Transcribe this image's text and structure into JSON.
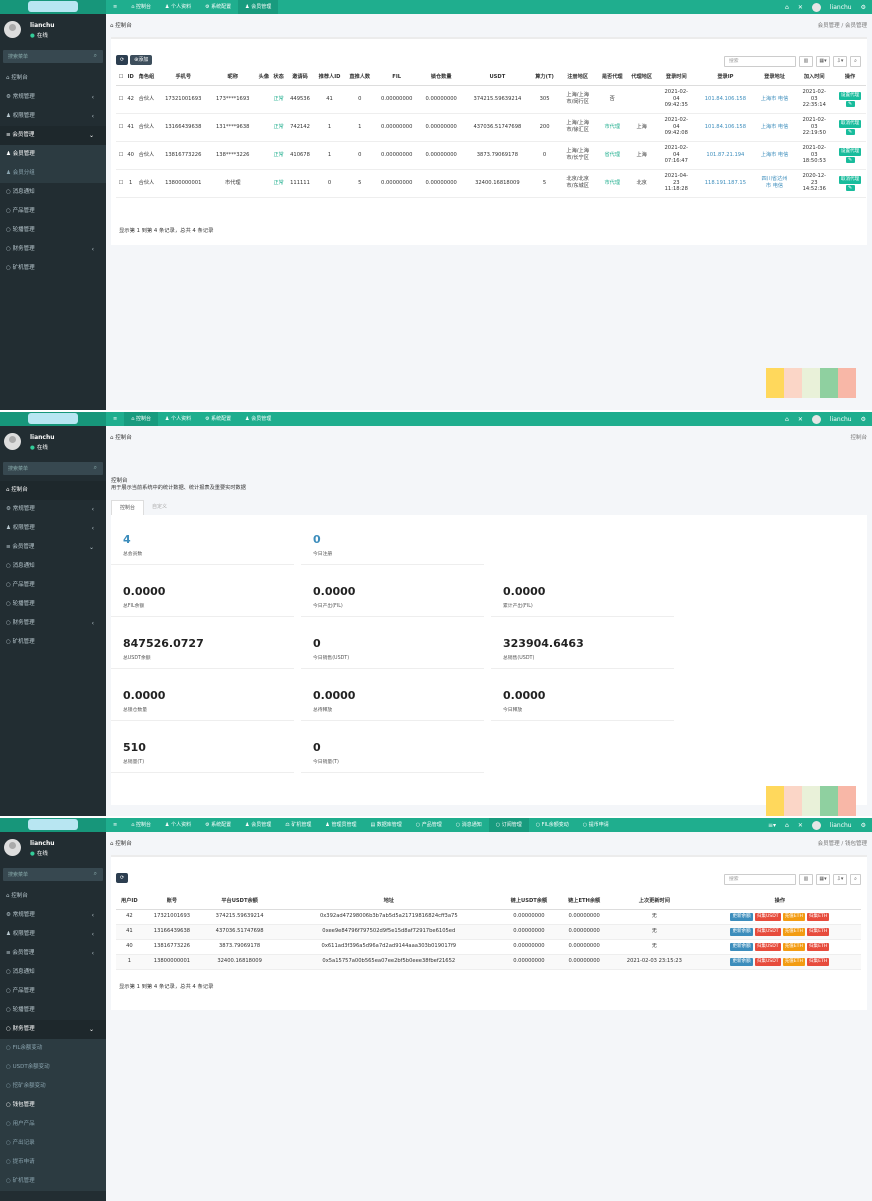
{
  "topnav": {
    "toggle": "≡",
    "dashboard": "控制台",
    "profile": "个人资料",
    "system": "系统配置",
    "member": "会员管理",
    "miner": "矿机管理",
    "admin": "管理员管理",
    "data": "数据库管理",
    "product": "产品管理",
    "notice": "消息通知",
    "subscribe": "订阅管理",
    "fil": "FIL余额变动",
    "withdraw": "提币申请"
  },
  "user": {
    "name": "lianchu",
    "status": "在线"
  },
  "search_placeholder": "搜索菜单",
  "menu": {
    "console": "控制台",
    "general": "常规管理",
    "auth": "权限管理",
    "member": "会员管理",
    "member_mgmt": "会员管理",
    "member_group": "会员分组",
    "notice": "消息通知",
    "product": "产品管理",
    "subscribe": "轮播管理",
    "finance": "财务管理",
    "miner": "矿机管理",
    "fil_change": "FIL余额变动",
    "usdt_change": "USDT余额变动",
    "dig_change": "挖矿余额变动",
    "withdraw_mgmt": "钱包管理",
    "user_products": "用户产品",
    "output": "产出记录",
    "withdraw_apply": "提币申请"
  },
  "p1": {
    "crumb": "控制台",
    "breadcrumb": "会员管理 / 会员管理",
    "add": "添加",
    "search": "搜索",
    "headers": [
      "ID",
      "角色组",
      "手机号",
      "昵称",
      "头像",
      "状态",
      "邀请码",
      "推荐人ID",
      "直推人数",
      "FIL",
      "锁仓数量",
      "USDT",
      "算力(T)",
      "注册地区",
      "是否代理",
      "代理地区",
      "登录时间",
      "登录IP",
      "登录地址",
      "加入时间",
      "操作"
    ],
    "rows": [
      {
        "id": "42",
        "role": "合伙人",
        "phone": "17321001693",
        "nick": "173****1693",
        "status": "正常",
        "code": "449536",
        "ref": "41",
        "direct": "0",
        "fil": "0.00000000",
        "lock": "0.00000000",
        "usdt": "374215.59639214",
        "power": "305",
        "region": "上海/上海市/闵行区",
        "agent": "否",
        "agent_region": "",
        "login_time": "2021-02-04 09:42:35",
        "ip": "101.84.106.158",
        "addr": "上海市 电信",
        "join": "2021-02-03 22:35:14",
        "op": "设置代理"
      },
      {
        "id": "41",
        "role": "合伙人",
        "phone": "13166439638",
        "nick": "131****9638",
        "status": "正常",
        "code": "742142",
        "ref": "1",
        "direct": "1",
        "fil": "0.00000000",
        "lock": "0.00000000",
        "usdt": "437036.51747698",
        "power": "200",
        "region": "上海/上海市/徐汇区",
        "agent": "市代理",
        "agent_region": "上海",
        "login_time": "2021-02-04 09:42:08",
        "ip": "101.84.106.158",
        "addr": "上海市 电信",
        "join": "2021-02-03 22:19:50",
        "op": "取消代理"
      },
      {
        "id": "40",
        "role": "合伙人",
        "phone": "13816773226",
        "nick": "138****3226",
        "status": "正常",
        "code": "410678",
        "ref": "1",
        "direct": "0",
        "fil": "0.00000000",
        "lock": "0.00000000",
        "usdt": "3873.79069178",
        "power": "0",
        "region": "上海/上海市/长宁区",
        "agent": "省代理",
        "agent_region": "上海",
        "login_time": "2021-02-04 07:16:47",
        "ip": "101.87.21.194",
        "addr": "上海市 电信",
        "join": "2021-02-03 18:50:53",
        "op": "设置代理"
      },
      {
        "id": "1",
        "role": "合伙人",
        "phone": "13800000001",
        "nick": "市代理",
        "status": "正常",
        "code": "111111",
        "ref": "0",
        "direct": "5",
        "fil": "0.00000000",
        "lock": "0.00000000",
        "usdt": "32400.16818009",
        "power": "5",
        "region": "北京/北京市/东城区",
        "agent": "市代理",
        "agent_region": "北京",
        "login_time": "2021-04-23 11:18:28",
        "ip": "118.191.187.15",
        "addr": "四川省达州市 电信",
        "join": "2020-12-23 14:52:36",
        "op": "取消代理"
      }
    ],
    "footer": "显示第 1 到第 4 条记录，总共 4 条记录"
  },
  "p2": {
    "crumb": "控制台",
    "right": "控制台",
    "title": "控制台",
    "subtitle": "用于展示当前系统中的统计数据、统计报表及重要实时数据",
    "tab1": "控制台",
    "tab2": "自定义",
    "stats": [
      {
        "v": "4",
        "l": "总会员数"
      },
      {
        "v": "0",
        "l": "今日注册"
      },
      {
        "v": "0.0000",
        "l": "总FIL余额"
      },
      {
        "v": "0.0000",
        "l": "今日产出(FIL)"
      },
      {
        "v": "0.0000",
        "l": "累计产出(FIL)"
      },
      {
        "v": "847526.0727",
        "l": "总USDT余额"
      },
      {
        "v": "0",
        "l": "今日销售(USDT)"
      },
      {
        "v": "323904.6463",
        "l": "总销售(USDT)"
      },
      {
        "v": "0.0000",
        "l": "总锁仓数量"
      },
      {
        "v": "0.0000",
        "l": "总待释放"
      },
      {
        "v": "0.0000",
        "l": "今日释放"
      },
      {
        "v": "510",
        "l": "总销量(T)"
      },
      {
        "v": "0",
        "l": "今日销量(T)"
      }
    ]
  },
  "p3": {
    "crumb": "控制台",
    "breadcrumb": "会员管理 / 钱包管理",
    "search": "搜索",
    "headers": [
      "用户ID",
      "账号",
      "平台USDT余额",
      "地址",
      "链上USDT余额",
      "链上ETH余额",
      "上次更新时间",
      "操作"
    ],
    "rows": [
      {
        "id": "42",
        "acc": "17321001693",
        "bal": "374215.59639214",
        "addr": "0x392ad47298006b3b7ab5d5a21719816824cff3a75",
        "usdt": "0.00000000",
        "eth": "0.00000000",
        "time": "无"
      },
      {
        "id": "41",
        "acc": "13166439638",
        "bal": "437036.51747698",
        "addr": "0xee9e84796f797502d9f5e15d8af72917be6105ed",
        "usdt": "0.00000000",
        "eth": "0.00000000",
        "time": "无"
      },
      {
        "id": "40",
        "acc": "13816773226",
        "bal": "3873.79069178",
        "addr": "0x611ad3f396a5d96a7d2ad9144aaa303b019017f9",
        "usdt": "0.00000000",
        "eth": "0.00000000",
        "time": "无"
      },
      {
        "id": "1",
        "acc": "13800000001",
        "bal": "32400.16818009",
        "addr": "0x5a15757a00b565ea07ee2bf5b0eee38fbef21652",
        "usdt": "0.00000000",
        "eth": "0.00000000",
        "time": "2021-02-03 23:15:23"
      }
    ],
    "ops": [
      "更新余额",
      "归集USDT",
      "充值ETH",
      "归集ETH"
    ],
    "footer": "显示第 1 到第 4 条记录，总共 4 条记录"
  }
}
